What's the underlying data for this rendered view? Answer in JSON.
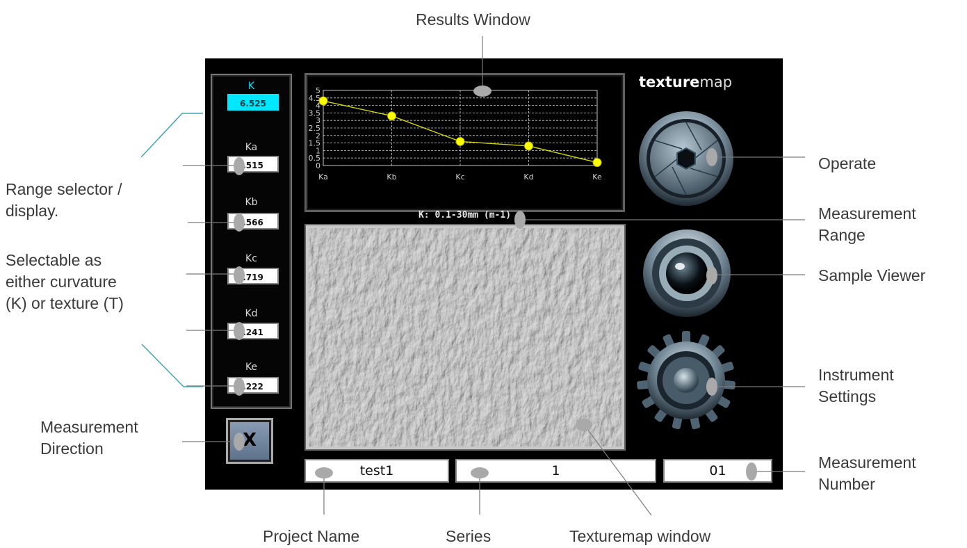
{
  "annotations": {
    "results_window": "Results Window",
    "range_selector": [
      "Range selector /",
      "display."
    ],
    "selectable": [
      "Selectable as",
      "either curvature",
      "(K) or texture (T)"
    ],
    "measurement_direction": [
      "Measurement",
      "Direction"
    ],
    "operate": "Operate",
    "measurement_range": [
      "Measurement",
      "Range"
    ],
    "sample_viewer": "Sample Viewer",
    "instrument_settings": [
      "Instrument",
      "Settings"
    ],
    "measurement_number": [
      "Measurement",
      "Number"
    ],
    "project_name": "Project Name",
    "series": "Series",
    "texturemap_window": "Texturemap window"
  },
  "app": {
    "brand_bold": "texture",
    "brand_light": "map",
    "k_title": "K",
    "k_value": "6.525",
    "range_items": [
      {
        "label": "Ka",
        "value": ".515"
      },
      {
        "label": "Kb",
        "value": ".566"
      },
      {
        "label": "Kc",
        "value": ".719"
      },
      {
        "label": "Kd",
        "value": ".241"
      },
      {
        "label": "Ke",
        "value": ".222"
      }
    ],
    "direction_label": "X",
    "range_text": "K: 0.1-30mm (m-1)",
    "project_name": "test1",
    "series": "1",
    "measurement_number": "01",
    "colors": {
      "accent": "#00e8ff",
      "plot_line": "#d4d400",
      "plot_point": "#ffff00"
    }
  },
  "chart_data": {
    "type": "line",
    "categories": [
      "Ka",
      "Kb",
      "Kc",
      "Kd",
      "Ke"
    ],
    "values": [
      4.3,
      3.3,
      1.6,
      1.3,
      0.2
    ],
    "ylim": [
      0,
      5
    ],
    "yticks": [
      "0",
      "0.5",
      "1",
      "1.5",
      "2",
      "2.5",
      "3",
      "3.5",
      "4",
      "4.5",
      "5"
    ],
    "grid": true
  }
}
